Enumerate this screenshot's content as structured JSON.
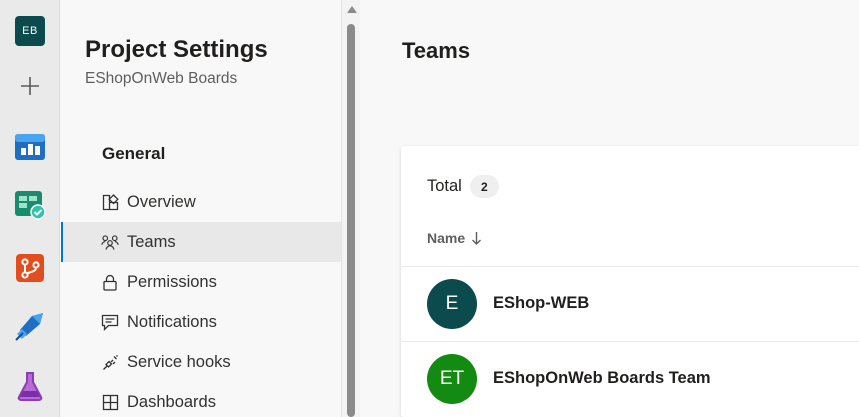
{
  "rail": {
    "org_initials": "EB",
    "items": [
      {
        "icon": "plus-icon"
      },
      {
        "icon": "overview-icon"
      },
      {
        "icon": "boards-icon"
      },
      {
        "icon": "repos-icon"
      },
      {
        "icon": "pipelines-icon"
      },
      {
        "icon": "test-plans-icon"
      }
    ]
  },
  "nav": {
    "title": "Project Settings",
    "subtitle": "EShopOnWeb Boards",
    "section": "General",
    "items": [
      {
        "label": "Overview",
        "icon": "overview-icon"
      },
      {
        "label": "Teams",
        "icon": "teams-icon",
        "selected": true
      },
      {
        "label": "Permissions",
        "icon": "lock-icon"
      },
      {
        "label": "Notifications",
        "icon": "chat-icon"
      },
      {
        "label": "Service hooks",
        "icon": "plug-icon"
      },
      {
        "label": "Dashboards",
        "icon": "grid-icon"
      }
    ]
  },
  "main": {
    "title": "Teams",
    "total_label": "Total",
    "total_count": "2",
    "column_name": "Name",
    "teams": [
      {
        "initials": "E",
        "name": "EShop-WEB",
        "color": "#0b4b4e"
      },
      {
        "initials": "ET",
        "name": "EShopOnWeb Boards Team",
        "color": "#138a12"
      }
    ]
  },
  "colors": {
    "accent": "#0078d4",
    "org_avatar": "#0b4b4e"
  }
}
